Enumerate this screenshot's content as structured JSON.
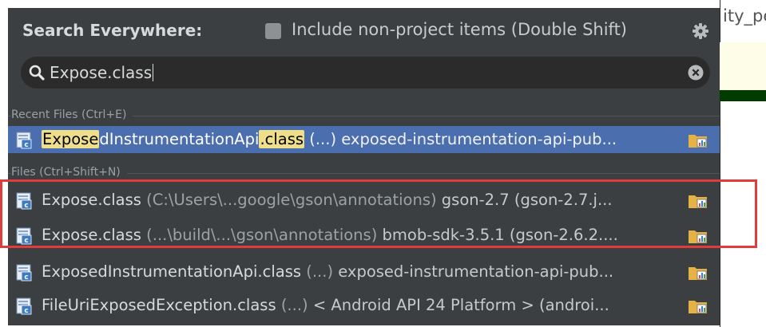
{
  "header": {
    "title": "Search Everywhere:",
    "include_label": "Include non-project items (Double Shift)"
  },
  "search": {
    "value": "Expose.class"
  },
  "editor_peek": {
    "text": "ity_pe"
  },
  "sections": {
    "recent": {
      "label": "Recent Files (Ctrl+E)"
    },
    "files": {
      "label": "Files (Ctrl+Shift+N)"
    }
  },
  "recent_items": [
    {
      "hl1": "Expose",
      "mid": "dInstrumentationApi",
      "hl2": ".class",
      "path": " (...)",
      "lib": " exposed-instrumentation-api-pub..."
    }
  ],
  "file_items": [
    {
      "name": "Expose.class",
      "path": " (C:\\Users\\...google\\gson\\annotations)",
      "lib": " gson-2.7 (gson-2.7.j..."
    },
    {
      "name": "Expose.class",
      "path": " (...\\build\\...\\gson\\annotations)",
      "lib": " bmob-sdk-3.5.1 (gson-2.6.2...."
    },
    {
      "name": "ExposedInstrumentationApi.class",
      "path": " (...)",
      "lib": " exposed-instrumentation-api-pub..."
    },
    {
      "name": "FileUriExposedException.class",
      "path": " (...)",
      "lib": " < Android API 24 Platform > (androi..."
    }
  ],
  "colors": {
    "popup_bg": "#3c3f41",
    "selection": "#4b6eaf",
    "match_highlight": "#f0df8a",
    "annotation_box": "#e03c3c"
  },
  "icons": {
    "gear": "gear-icon",
    "search": "search-icon",
    "clear": "clear-icon",
    "file": "class-file-icon",
    "library": "library-folder-icon"
  }
}
